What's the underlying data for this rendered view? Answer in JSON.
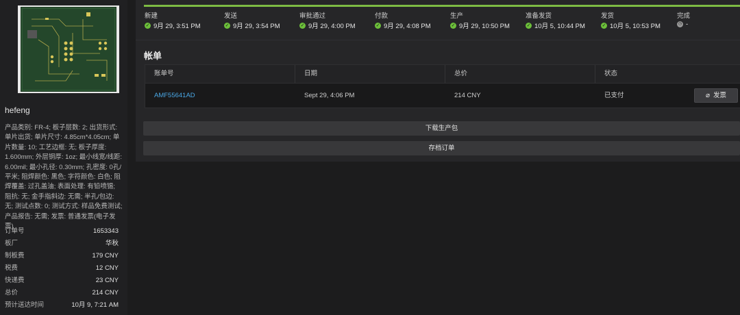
{
  "sidebar": {
    "username": "hefeng",
    "description": "产品类别: FR-4; 板子层数: 2; 出货形式: 单片出货; 单片尺寸: 4.85cm*4.05cm; 单片数量: 10; 工艺边框: 无; 板子厚度: 1.600mm; 外层铜厚: 1oz; 最小线宽/线距: 6.00mil; 最小孔径: 0.30mm; 孔密度: 0孔/平米; 阻焊颜色: 黑色; 字符颜色: 白色; 阻焊覆盖: 过孔盖油; 表面处理: 有铅喷锡; 阻抗: 无; 金手指斜边: 无需; 半孔/包边: 无; 测试点数: 0; 测试方式: 样品免费测试; 产品报告: 无需; 发票: 普通发票(电子发票)",
    "details": [
      {
        "label": "订单号",
        "value": "1653343"
      },
      {
        "label": "板厂",
        "value": "华秋"
      },
      {
        "label": "制板费",
        "value": "179 CNY"
      },
      {
        "label": "税费",
        "value": "12 CNY"
      },
      {
        "label": "快递费",
        "value": "23 CNY"
      },
      {
        "label": "总价",
        "value": "214 CNY"
      },
      {
        "label": "预计送达时间",
        "value": "10月 9, 7:21 AM"
      }
    ]
  },
  "progress": {
    "steps": [
      {
        "title": "新建",
        "time": "9月 29, 3:51 PM",
        "done": true
      },
      {
        "title": "发送",
        "time": "9月 29, 3:54 PM",
        "done": true
      },
      {
        "title": "审批通过",
        "time": "9月 29, 4:00 PM",
        "done": true
      },
      {
        "title": "付款",
        "time": "9月 29, 4:08 PM",
        "done": true
      },
      {
        "title": "生产",
        "time": "9月 29, 10:50 PM",
        "done": true
      },
      {
        "title": "准备发货",
        "time": "10月 5, 10:44 PM",
        "done": true
      },
      {
        "title": "发货",
        "time": "10月 5, 10:53 PM",
        "done": true
      },
      {
        "title": "完成",
        "time": "-",
        "done": false
      }
    ]
  },
  "billing": {
    "title": "帐单",
    "columns": [
      "账单号",
      "日期",
      "总价",
      "状态"
    ],
    "row": {
      "id": "AMF55641AD",
      "date": "Sept 29, 4:06 PM",
      "total": "214 CNY",
      "status": "已支付"
    },
    "invoice_label": "发票"
  },
  "actions": {
    "download_label": "下载生产包",
    "archive_label": "存档订单"
  },
  "colors": {
    "accent": "#7dbb43",
    "link": "#4aa8e6"
  }
}
